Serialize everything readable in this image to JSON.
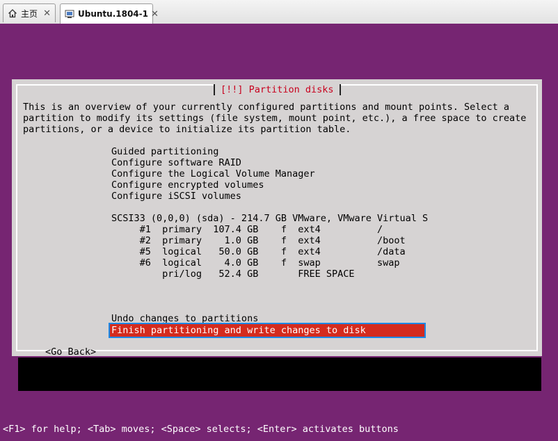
{
  "tabs": [
    {
      "label": "主页",
      "icon": "home-icon",
      "active": false
    },
    {
      "label": "Ubuntu.1804-1",
      "icon": "vm-icon",
      "active": true
    }
  ],
  "dialog": {
    "title": "[!!] Partition disks",
    "intro": [
      "This is an overview of your currently configured partitions and mount points. Select a",
      "partition to modify its settings (file system, mount point, etc.), a free space to create",
      "partitions, or a device to initialize its partition table."
    ],
    "menu": [
      "Guided partitioning",
      "Configure software RAID",
      "Configure the Logical Volume Manager",
      "Configure encrypted volumes",
      "Configure iSCSI volumes"
    ],
    "disk": "SCSI33 (0,0,0) (sda) - 214.7 GB VMware, VMware Virtual S",
    "partitions": [
      "     #1  primary  107.4 GB    f  ext4          /",
      "     #2  primary    1.0 GB    f  ext4          /boot",
      "     #5  logical   50.0 GB    f  ext4          /data",
      "     #6  logical    4.0 GB    f  swap          swap",
      "         pri/log   52.4 GB       FREE SPACE"
    ],
    "undo": "Undo changes to partitions",
    "finish": "Finish partitioning and write changes to disk",
    "go_back": "<Go Back>"
  },
  "status_bar": "<F1> for help; <Tab> moves; <Space> selects; <Enter> activates buttons",
  "colors": {
    "console_bg": "#762572",
    "dialog_bg": "#d6d3d3",
    "title_color": "#c8001e",
    "highlight_bg": "#d42b1e",
    "focus_outline": "#1e88e5"
  }
}
